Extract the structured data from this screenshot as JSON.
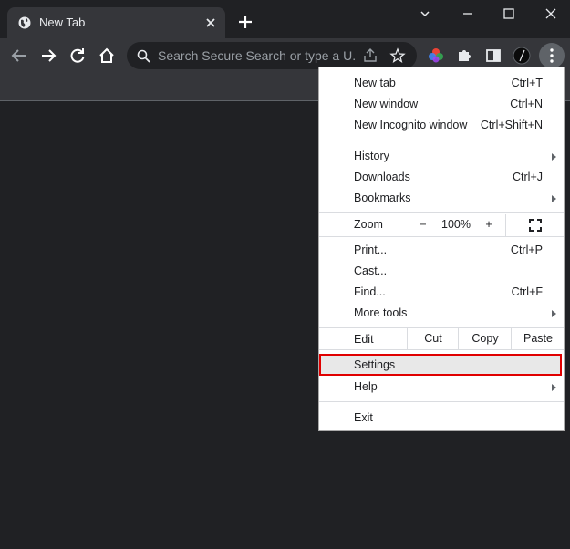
{
  "tab": {
    "title": "New Tab",
    "favicon": "globe-icon"
  },
  "omnibox": {
    "placeholder": "Search Secure Search or type a U..."
  },
  "window_controls": [
    "minimize",
    "maximize",
    "close"
  ],
  "menu": {
    "new_tab": {
      "label": "New tab",
      "shortcut": "Ctrl+T"
    },
    "new_window": {
      "label": "New window",
      "shortcut": "Ctrl+N"
    },
    "new_incognito": {
      "label": "New Incognito window",
      "shortcut": "Ctrl+Shift+N"
    },
    "history": {
      "label": "History"
    },
    "downloads": {
      "label": "Downloads",
      "shortcut": "Ctrl+J"
    },
    "bookmarks": {
      "label": "Bookmarks"
    },
    "zoom": {
      "label": "Zoom",
      "minus": "−",
      "value": "100%",
      "plus": "+"
    },
    "print": {
      "label": "Print...",
      "shortcut": "Ctrl+P"
    },
    "cast": {
      "label": "Cast..."
    },
    "find": {
      "label": "Find...",
      "shortcut": "Ctrl+F"
    },
    "more_tools": {
      "label": "More tools"
    },
    "edit": {
      "label": "Edit",
      "cut": "Cut",
      "copy": "Copy",
      "paste": "Paste"
    },
    "settings": {
      "label": "Settings",
      "highlight_color": "#e00000"
    },
    "help": {
      "label": "Help"
    },
    "exit": {
      "label": "Exit"
    }
  }
}
